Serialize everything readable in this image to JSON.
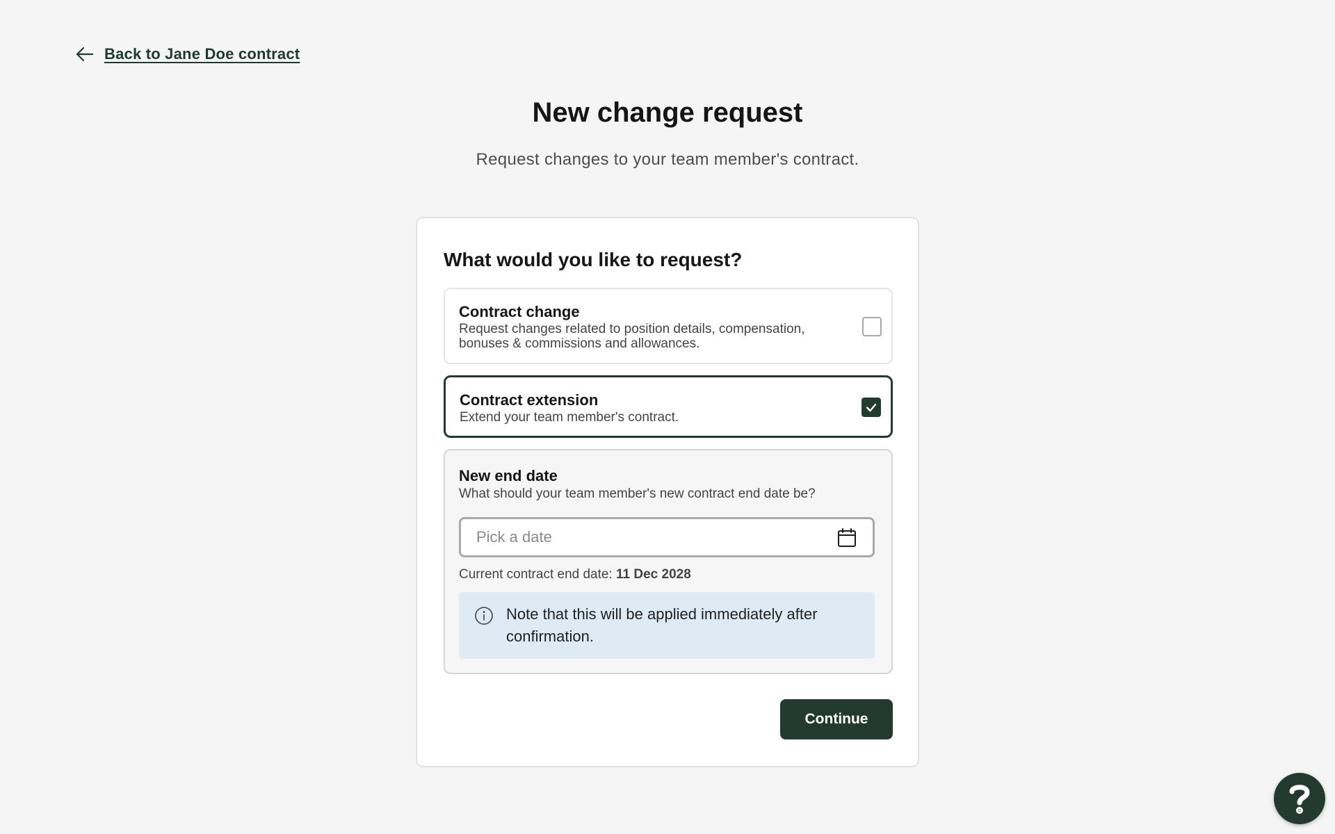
{
  "nav": {
    "back_label": "Back to Jane Doe contract"
  },
  "header": {
    "title": "New change request",
    "subtitle": "Request changes to your team member's contract."
  },
  "form": {
    "question": "What would you like to request?",
    "options": [
      {
        "title": "Contract change",
        "description": "Request changes related to position details, compensation, bonuses & commissions and allowances.",
        "checked": false
      },
      {
        "title": "Contract extension",
        "description": "Extend your team member's contract.",
        "checked": true
      }
    ],
    "end_date": {
      "title": "New end date",
      "description": "What should your team member's new contract end date be?",
      "placeholder": "Pick a date",
      "value": "",
      "current_label": "Current contract end date:",
      "current_value": "11 Dec 2028",
      "note": "Note that this will be applied immediately after confirmation."
    },
    "continue_label": "Continue"
  },
  "colors": {
    "brand": "#223a30",
    "background": "#f5f5f5",
    "note_background": "#deeaf4"
  },
  "icons": [
    "arrow-left-icon",
    "checkmark-icon",
    "calendar-icon",
    "info-icon",
    "question-mark-icon"
  ]
}
